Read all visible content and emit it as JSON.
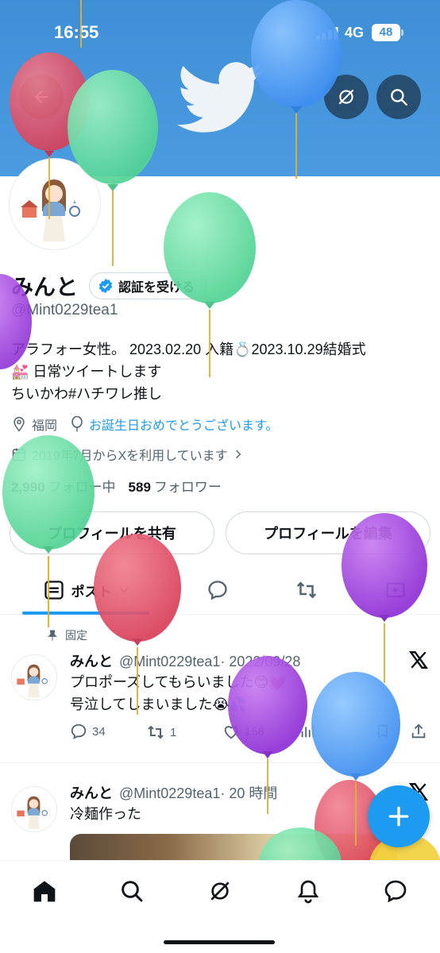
{
  "status_bar": {
    "time": "16:55",
    "network": "4G",
    "battery": "48"
  },
  "profile": {
    "name": "みんと",
    "verify_label": "認証を受ける",
    "handle": "@Mint0229tea1",
    "bio_lines": [
      "アラフォー女性。 2023.02.20 入籍💍2023.10.29結婚式",
      "💒 日常ツイートします",
      "ちいかわ#ハチワレ推し"
    ],
    "location": "福岡",
    "birthday_text": "お誕生日おめでとうございます。",
    "joined": "2019年7月からXを利用しています",
    "following_count": "2,990",
    "following_label": "フォロー中",
    "followers_count": "589",
    "followers_label": "フォロワー"
  },
  "buttons": {
    "share_profile": "プロフィールを共有",
    "edit_profile": "プロフィールを編集"
  },
  "tabs": {
    "posts": "ポスト"
  },
  "pinned_label": "固定",
  "tweets": [
    {
      "name": "みんと",
      "handle": "@Mint0229tea1",
      "time": "· 2022/09/28",
      "lines": [
        "プロポーズしてもらいました😊💓",
        "号泣してしまいました😭💦"
      ],
      "replies": "34",
      "retweets": "1",
      "likes": "158"
    },
    {
      "name": "みんと",
      "handle": "@Mint0229tea1",
      "time": "· 20 時間",
      "lines": [
        "冷麺作った"
      ]
    }
  ],
  "colors": {
    "accent": "#1d9bf0",
    "banner": "#4a9be0",
    "text": "#0f1419",
    "muted": "#536471"
  },
  "icons": [
    "back-arrow-icon",
    "grok-icon",
    "search-icon",
    "verified-badge-icon",
    "location-icon",
    "balloon-icon",
    "calendar-icon",
    "chevron-right-icon",
    "posts-icon",
    "chevron-down-icon",
    "replies-icon",
    "retweet-icon",
    "video-icon",
    "pin-icon",
    "x-logo-icon",
    "reply-icon",
    "like-icon",
    "views-icon",
    "bookmark-icon",
    "share-icon",
    "plus-icon",
    "home-icon",
    "grok-nav-icon",
    "notifications-icon",
    "messages-icon"
  ]
}
